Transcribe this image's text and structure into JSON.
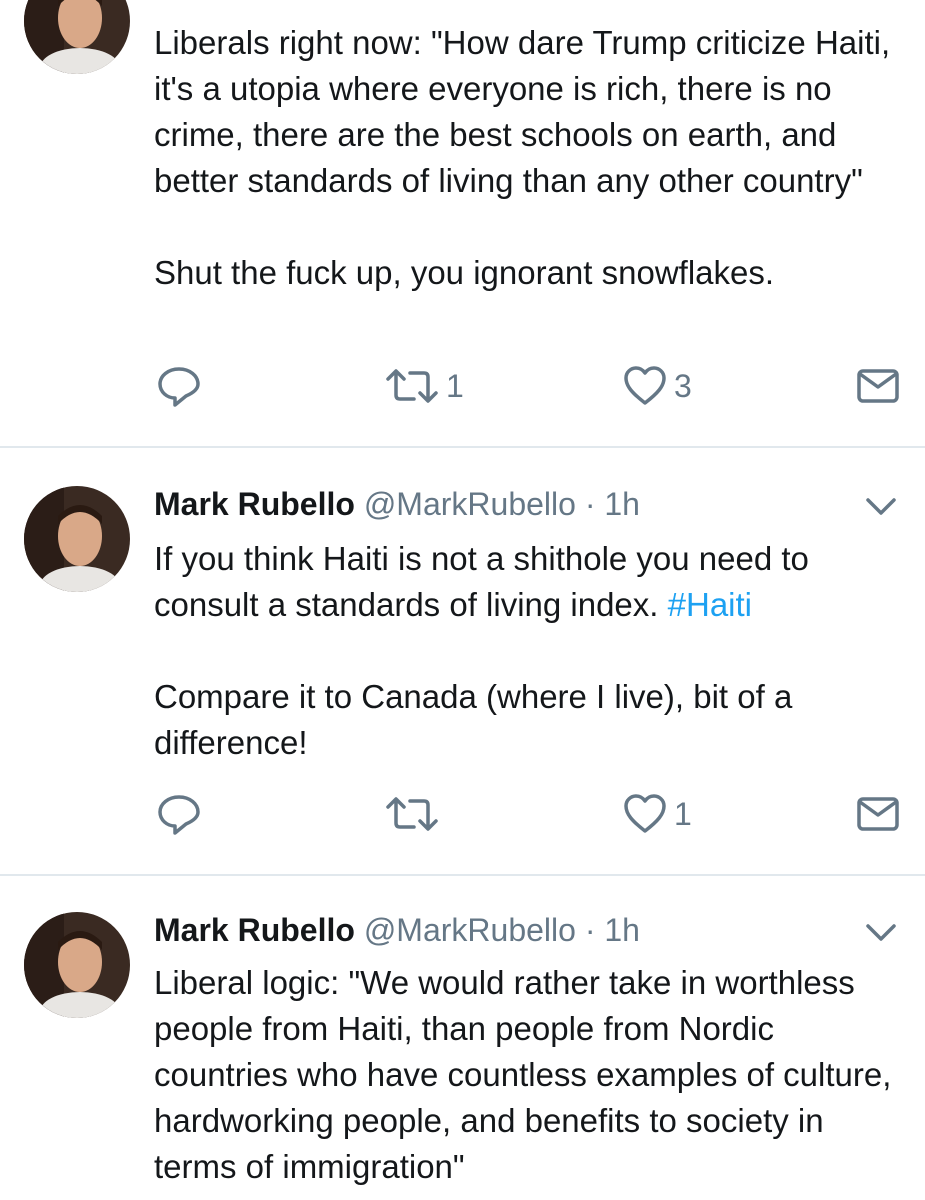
{
  "colors": {
    "link": "#1da1f2",
    "muted": "#657786",
    "text": "#14171a",
    "divider": "#e1e8ed"
  },
  "tweets": [
    {
      "name": "",
      "handle": "",
      "time": "",
      "paragraphs": [
        "Liberals right now: \"How dare Trump criticize Haiti, it's a utopia where everyone is rich, there is no crime, there are the best schools on earth, and better standards of living than any other country\"",
        "Shut the fuck up, you ignorant snowflakes."
      ],
      "retweets": "1",
      "likes": "3"
    },
    {
      "name": "Mark Rubello",
      "handle": "@MarkRubello",
      "dot": "·",
      "time": "1h",
      "p1": "If you think Haiti is not a shithole you need to consult a standards of living index.",
      "hashtag": "#Haiti",
      "p2": "Compare it to Canada (where I live), bit of a difference!",
      "retweets": "",
      "likes": "1"
    },
    {
      "name": "Mark Rubello",
      "handle": "@MarkRubello",
      "dot": "·",
      "time": "1h",
      "paragraphs": [
        "Liberal logic: \"We would rather take in worthless people from Haiti, than people from Nordic countries who have countless examples of culture, hardworking people, and benefits to society in terms of immigration\""
      ]
    }
  ],
  "icons": {
    "reply": "reply-icon",
    "retweet": "retweet-icon",
    "like": "heart-icon",
    "dm": "envelope-icon",
    "caret": "chevron-down-icon"
  }
}
